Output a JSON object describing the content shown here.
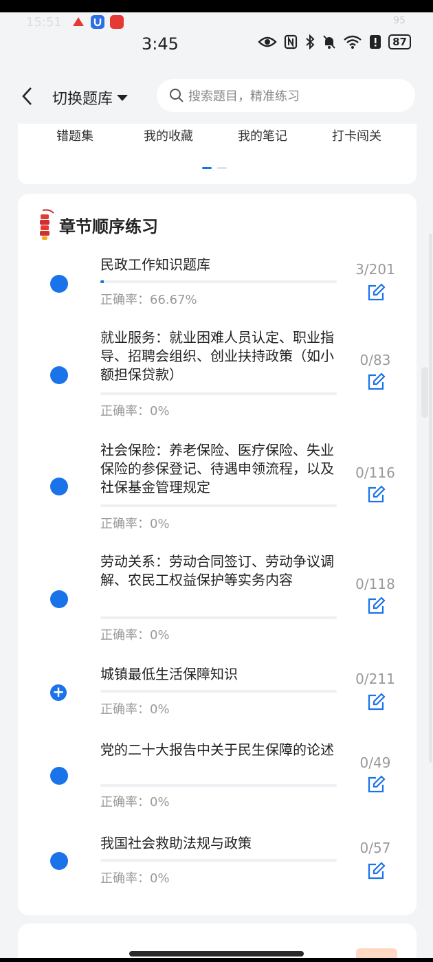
{
  "status_bar": {
    "time": "3:45",
    "battery": "87",
    "ghost_time": "15:51",
    "ghost_battery": "95"
  },
  "header": {
    "switch_label": "切换题库",
    "search_placeholder": "搜索题目，精准练习"
  },
  "quick_tabs": [
    "错题集",
    "我的收藏",
    "我的笔记",
    "打卡闯关"
  ],
  "section": {
    "title": "章节顺序练习",
    "icon": "firecracker-icon"
  },
  "chapters": [
    {
      "title": "民政工作知识题库",
      "count": "3/201",
      "accuracy": "正确率：66.67%",
      "progress": 0.015,
      "bullet": "dot"
    },
    {
      "title": "就业服务：就业困难人员认定、职业指导、招聘会组织、创业扶持政策（如小额担保贷款）",
      "count": "0/83",
      "accuracy": "正确率：0%",
      "progress": 0,
      "bullet": "dot"
    },
    {
      "title": "社会保险：养老保险、医疗保险、失业保险的参保登记、待遇申领流程，以及社保基金管理规定",
      "count": "0/116",
      "accuracy": "正确率：0%",
      "progress": 0,
      "bullet": "dot"
    },
    {
      "title": "劳动关系：劳动合同签订、劳动争议调解、农民工权益保护等实务内容",
      "count": "0/118",
      "accuracy": "正确率：0%",
      "progress": 0,
      "bullet": "dot"
    },
    {
      "title": "城镇最低生活保障知识",
      "count": "0/211",
      "accuracy": "正确率：0%",
      "progress": 0,
      "bullet": "plus"
    },
    {
      "title": "党的二十大报告中关于民生保障的论述",
      "count": "0/49",
      "accuracy": "正确率：0%",
      "progress": 0,
      "bullet": "dot"
    },
    {
      "title": "我国社会救助法规与政策",
      "count": "0/57",
      "accuracy": "正确率：0%",
      "progress": 0,
      "bullet": "dot"
    }
  ],
  "colors": {
    "accent": "#1a73e8",
    "muted": "#999999",
    "page_bg": "#f3f4f6"
  }
}
